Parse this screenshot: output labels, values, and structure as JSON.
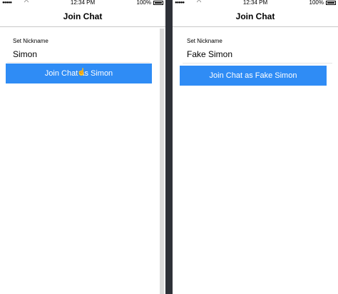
{
  "left": {
    "status": {
      "time": "12:34 PM",
      "battery": "100%",
      "signal_icon": "signal-dots-icon",
      "wifi_icon": "wifi-icon",
      "battery_icon": "battery-icon"
    },
    "nav_title": "Join Chat",
    "field_label": "Set Nickname",
    "nickname_value": "Simon",
    "button_label": "Join Chat as Simon"
  },
  "right": {
    "status": {
      "time": "12:34 PM",
      "battery": "100%",
      "signal_icon": "signal-dots-icon",
      "wifi_icon": "wifi-icon",
      "battery_icon": "battery-icon"
    },
    "nav_title": "Join Chat",
    "field_label": "Set Nickname",
    "nickname_value": "Fake Simon",
    "button_label": "Join Chat as Fake Simon"
  },
  "colors": {
    "button": "#2f8cf5",
    "divider": "#2e3138"
  }
}
